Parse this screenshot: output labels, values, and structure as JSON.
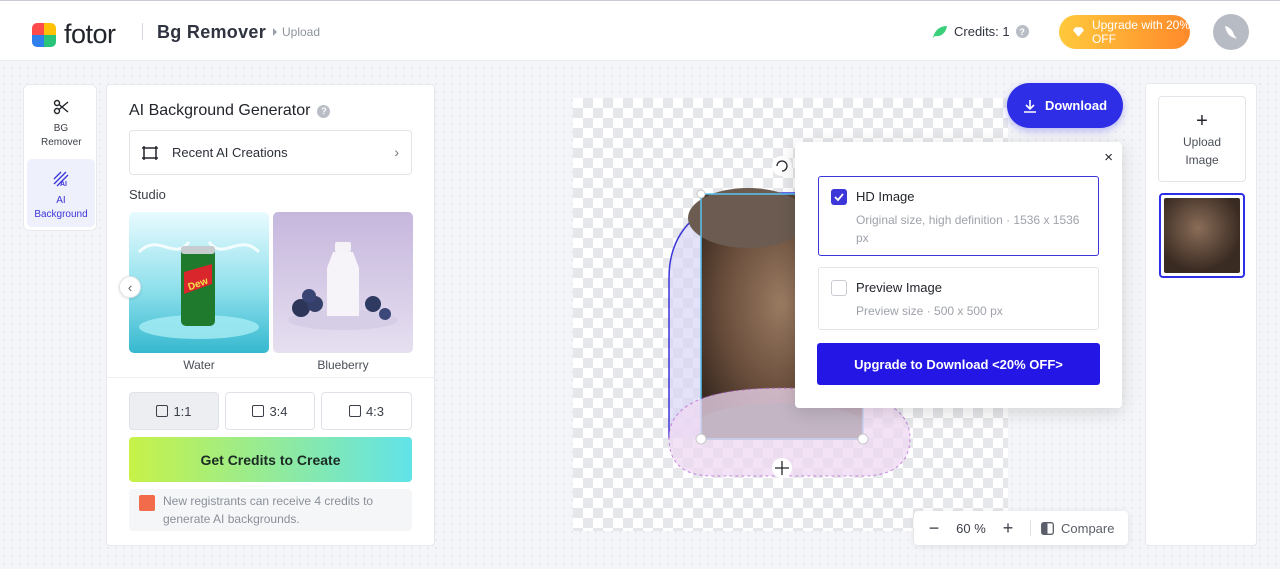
{
  "header": {
    "logo_text": "fotor",
    "app_title": "Bg Remover",
    "breadcrumb": "Upload",
    "credits_label": "Credits: 1",
    "help_glyph": "?",
    "upgrade_label": "Upgrade with 20% OFF",
    "icons": [
      "leaf-icon",
      "help-icon",
      "diamond-icon",
      "avatar-bird-icon"
    ]
  },
  "toolrail": {
    "items": [
      {
        "label": "BG Remover",
        "icon": "scissors-icon"
      },
      {
        "label": "AI Background",
        "icon": "ai-background-icon"
      }
    ]
  },
  "panel": {
    "title": "AI Background Generator",
    "help_glyph": "?",
    "recent_label": "Recent AI Creations",
    "studio_label": "Studio",
    "styles": [
      {
        "label": "Water"
      },
      {
        "label": "Blueberry"
      }
    ],
    "prev_glyph": "‹",
    "ratios": [
      {
        "label": "1:1",
        "selected": true
      },
      {
        "label": "3:4",
        "selected": false
      },
      {
        "label": "4:3",
        "selected": false
      }
    ],
    "cta_label": "Get Credits to Create",
    "note": "New registrants can receive 4 credits to generate AI backgrounds."
  },
  "canvas": {
    "download_label": "Download"
  },
  "download_popup": {
    "close_glyph": "×",
    "options": [
      {
        "title": "HD Image",
        "desc": "Original size, high definition · 1536 x 1536 px",
        "checked": true
      },
      {
        "title": "Preview Image",
        "desc": "Preview size · 500 x 500 px",
        "checked": false
      }
    ],
    "upgrade_label": "Upgrade to Download <20% OFF>"
  },
  "zoom": {
    "minus": "−",
    "value": "60 %",
    "plus": "+",
    "compare_label": "Compare"
  },
  "rightrail": {
    "plus_glyph": "+",
    "upload_label": "Upload Image"
  },
  "colors": {
    "accent": "#2d2ee6",
    "upgrade_gradient": [
      "#ffc93c",
      "#ff8a2b"
    ],
    "cta_gradient": [
      "#c7f247",
      "#61e3e8"
    ]
  }
}
